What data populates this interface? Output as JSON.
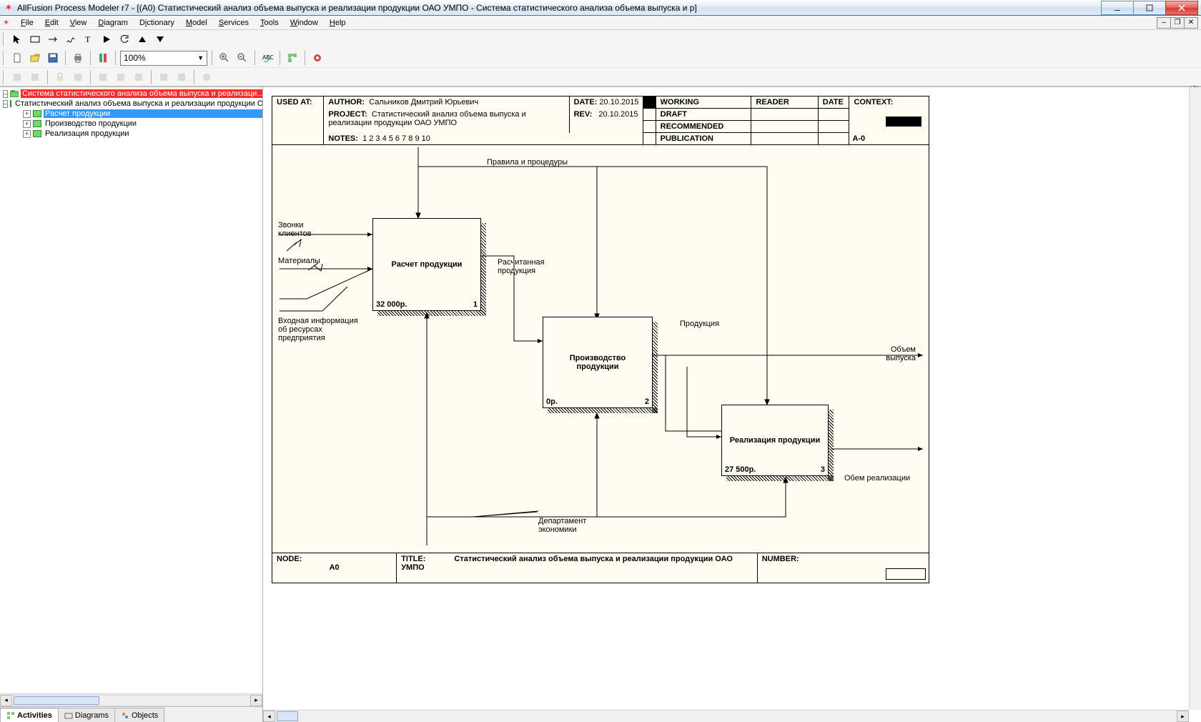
{
  "titlebar": {
    "text": "AllFusion Process Modeler r7 - [(A0) Статистический анализ объема выпуска и реализации продукции ОАО УМПО - Система статистического анализа объема выпуска и р]"
  },
  "menu": [
    "File",
    "Edit",
    "View",
    "Diagram",
    "Dictionary",
    "Model",
    "Services",
    "Tools",
    "Window",
    "Help"
  ],
  "zoom": "100%",
  "tree": {
    "root": "Система статистического анализа объема выпуска и реализаци...",
    "n1": "Статистический анализ объема выпуска и реализации продукции ОАО У",
    "n2": "Расчет продукции",
    "n3": "Производство продукции",
    "n4": "Реализация  продукции"
  },
  "navtabs": {
    "activities": "Activities",
    "diagrams": "Diagrams",
    "objects": "Objects"
  },
  "header": {
    "used_at_lbl": "USED AT:",
    "author_lbl": "AUTHOR:",
    "author": "Сальников Дмитрий Юрьевич",
    "project_lbl": "PROJECT:",
    "project": "Статистический анализ объема выпуска и реализации продукции ОАО УМПО",
    "date_lbl": "DATE:",
    "date": "20.10.2015",
    "rev_lbl": "REV:",
    "rev": "20.10.2015",
    "notes_lbl": "NOTES:",
    "notes": "1  2  3  4  5  6  7  8  9  10",
    "working": "WORKING",
    "draft": "DRAFT",
    "recommended": "RECOMMENDED",
    "publication": "PUBLICATION",
    "reader": "READER",
    "rdate": "DATE",
    "context": "CONTEXT:",
    "context_id": "A-0"
  },
  "boxes": {
    "b1": {
      "name": "Расчет продукции",
      "cost": "32 000р.",
      "num": "1"
    },
    "b2": {
      "name": "Производство продукции",
      "cost": "0р.",
      "num": "2"
    },
    "b3": {
      "name": "Реализация продукции",
      "cost": "27 500р.",
      "num": "3"
    }
  },
  "labels": {
    "rules": "Правила и процедуры",
    "calls": "Звонки клиентов",
    "materials": "Материалы",
    "resinfo": "Входная информация об ресурсах предприятия",
    "calcprod": "Расчитанная продукция",
    "prod": "Продукция",
    "volout": "Объем выпуска",
    "volreal": "Обем реализации",
    "dept": "Департамент экономики"
  },
  "footer": {
    "node_lbl": "NODE:",
    "node": "A0",
    "title_lbl": "TITLE:",
    "title": "Статистический анализ объема выпуска и реализации продукции ОАО УМПО",
    "number_lbl": "NUMBER:"
  }
}
